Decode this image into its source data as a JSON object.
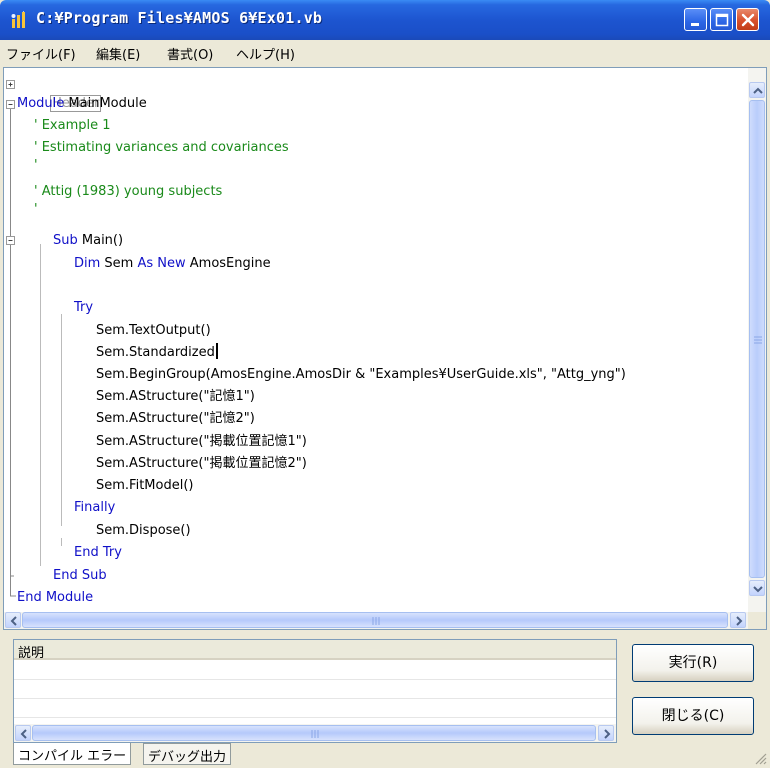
{
  "window": {
    "title": "C:¥Program Files¥AMOS 6¥Ex01.vb"
  },
  "menu": {
    "items": [
      "ファイル(F)",
      "編集(E)",
      "書式(O)",
      "ヘルプ(H)"
    ]
  },
  "editor": {
    "lines": [
      [
        {
          "t": "Header",
          "c": "box"
        }
      ],
      [
        {
          "t": "Module",
          "c": "kw"
        },
        {
          "t": " MainModule",
          "c": "id"
        }
      ],
      [
        {
          "t": "' Example 1",
          "c": "cm"
        }
      ],
      [
        {
          "t": "' Estimating variances and covariances",
          "c": "cm"
        }
      ],
      [
        {
          "t": "'",
          "c": "cm"
        }
      ],
      [
        {
          "t": "' Attig (1983) young subjects",
          "c": "cm"
        }
      ],
      [
        {
          "t": "'",
          "c": "cm"
        }
      ],
      [
        {
          "t": "Sub",
          "c": "kw"
        },
        {
          "t": " Main()",
          "c": "id"
        }
      ],
      [
        {
          "t": "Dim",
          "c": "kw"
        },
        {
          "t": " Sem ",
          "c": "id"
        },
        {
          "t": "As New",
          "c": "kw"
        },
        {
          "t": " AmosEngine",
          "c": "id"
        }
      ],
      [],
      [
        {
          "t": "Try",
          "c": "kw"
        }
      ],
      [
        {
          "t": "Sem.TextOutput()",
          "c": "id"
        }
      ],
      [
        {
          "t": "Sem.Standardized",
          "c": "id"
        }
      ],
      [
        {
          "t": "Sem.BeginGroup(AmosEngine.AmosDir & \"Examples¥UserGuide.xls\", \"Attg_yng\")",
          "c": "id"
        }
      ],
      [
        {
          "t": "Sem.AStructure(\"記憶1\")",
          "c": "id"
        }
      ],
      [
        {
          "t": "Sem.AStructure(\"記憶2\")",
          "c": "id"
        }
      ],
      [
        {
          "t": "Sem.AStructure(\"掲載位置記憶1\")",
          "c": "id"
        }
      ],
      [
        {
          "t": "Sem.AStructure(\"掲載位置記憶2\")",
          "c": "id"
        }
      ],
      [
        {
          "t": "Sem.FitModel()",
          "c": "id"
        }
      ],
      [
        {
          "t": "Finally",
          "c": "kw"
        }
      ],
      [
        {
          "t": "Sem.Dispose()",
          "c": "id"
        }
      ],
      [
        {
          "t": "End Try",
          "c": "kw"
        }
      ],
      [
        {
          "t": "End Sub",
          "c": "kw"
        }
      ],
      [
        {
          "t": "End Module",
          "c": "kw"
        }
      ]
    ]
  },
  "description": {
    "header": "説明"
  },
  "buttons": {
    "run": "実行(R)",
    "close": "閉じる(C)"
  },
  "tabs": {
    "compile_errors": "コンパイル エラー",
    "debug_output": "デバッグ出力"
  },
  "colors": {
    "keyword": "#1010c8",
    "comment": "#1a8a1a",
    "title_bar": "#1d55d0"
  }
}
